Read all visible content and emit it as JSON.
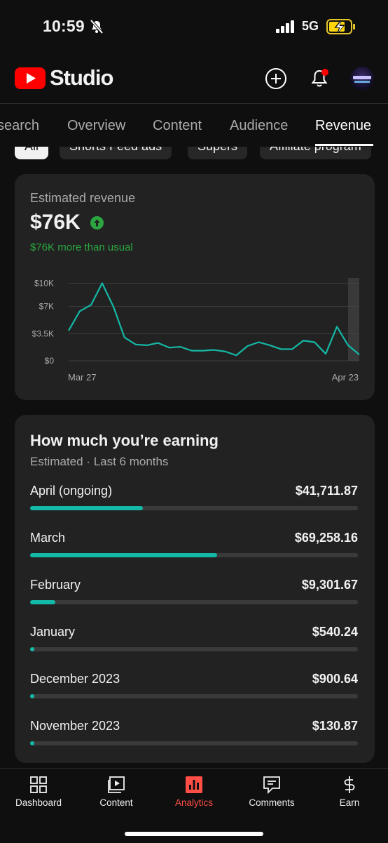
{
  "status_bar": {
    "time": "10:59",
    "network": "5G"
  },
  "header": {
    "app_name": "Studio"
  },
  "tabs": [
    {
      "label": "search"
    },
    {
      "label": "Overview"
    },
    {
      "label": "Content"
    },
    {
      "label": "Audience"
    },
    {
      "label": "Revenue",
      "active": true
    }
  ],
  "chips": [
    {
      "label": "All",
      "selected": true
    },
    {
      "label": "Shorts Feed ads"
    },
    {
      "label": "Supers"
    },
    {
      "label": "Affiliate program"
    }
  ],
  "revenue_card": {
    "label": "Estimated revenue",
    "value": "$76K",
    "comparison": "$76K more than usual"
  },
  "chart_data": {
    "type": "line",
    "x_start": "Mar 27",
    "x_end": "Apr 23",
    "ytick_labels": [
      "$10K",
      "$7K",
      "$3.5K",
      "$0"
    ],
    "ylim": [
      0,
      10500
    ],
    "grid": true,
    "color": "#14b8a6",
    "series": [
      {
        "values": [
          3900,
          6400,
          7200,
          10000,
          7000,
          3000,
          2100,
          2000,
          2300,
          1700,
          1800,
          1300,
          1300,
          1400,
          1200,
          700,
          1900,
          2400,
          2000,
          1500,
          1500,
          2600,
          2400,
          900,
          4400,
          2000,
          800
        ]
      }
    ]
  },
  "earnings_card": {
    "title": "How much you’re earning",
    "subtitle": "Estimated · Last 6 months",
    "rows": [
      {
        "label": "April (ongoing)",
        "amount": "$41,711.87",
        "fraction": 0.344
      },
      {
        "label": "March",
        "amount": "$69,258.16",
        "fraction": 0.57
      },
      {
        "label": "February",
        "amount": "$9,301.67",
        "fraction": 0.076
      },
      {
        "label": "January",
        "amount": "$540.24",
        "fraction": 0.005
      },
      {
        "label": "December 2023",
        "amount": "$900.64",
        "fraction": 0.007
      },
      {
        "label": "November 2023",
        "amount": "$130.87",
        "fraction": 0.001
      }
    ]
  },
  "bottom_nav": [
    {
      "label": "Dashboard",
      "icon": "dashboard-icon"
    },
    {
      "label": "Content",
      "icon": "content-icon"
    },
    {
      "label": "Analytics",
      "icon": "analytics-icon",
      "active": true
    },
    {
      "label": "Comments",
      "icon": "comments-icon"
    },
    {
      "label": "Earn",
      "icon": "earn-icon"
    }
  ],
  "colors": {
    "accent": "#14b8a6",
    "brand": "#ff0000",
    "active_nav": "#ff4e45",
    "positive": "#2ba640"
  }
}
